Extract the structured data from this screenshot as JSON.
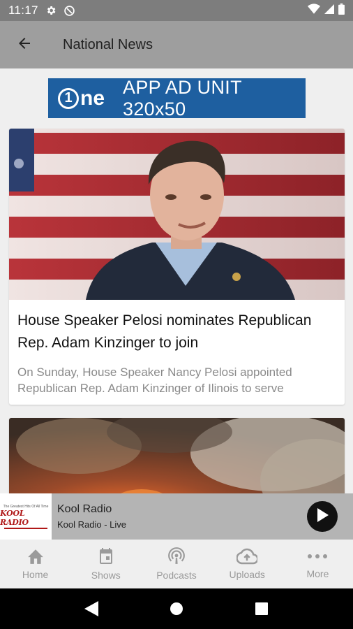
{
  "status_bar": {
    "time": "11:17",
    "icons_left": [
      "settings-gear-icon",
      "do-not-disturb-icon"
    ],
    "icons_right": [
      "wifi-icon",
      "cellular-signal-icon",
      "battery-icon"
    ]
  },
  "app_bar": {
    "back_icon": "arrow-left-icon",
    "title": "National News"
  },
  "ad_banner": {
    "logo": "1ne",
    "text": "APP AD UNIT 320x50",
    "color": "#1e5fa0"
  },
  "articles": [
    {
      "headline": "House Speaker Pelosi nominates Republican Rep. Adam Kinzinger to join",
      "summary": "On Sunday, House Speaker Nancy Pelosi appointed Republican Rep. Adam Kinzinger of Ilinois to serve",
      "image": "photo-man-speaking-in-front-of-american-flag"
    },
    {
      "headline": "",
      "summary": "",
      "image": "photo-wildfire-smoke"
    }
  ],
  "player": {
    "art_tagline": "The Greatest Hits Of All Time",
    "art_brand": "KOOL RADIO",
    "station": "Kool Radio",
    "subtitle": "Kool Radio - Live",
    "play_icon": "play-icon"
  },
  "bottom_nav": {
    "tabs": [
      {
        "label": "Home",
        "icon": "home-icon"
      },
      {
        "label": "Shows",
        "icon": "calendar-icon"
      },
      {
        "label": "Podcasts",
        "icon": "podcast-icon"
      },
      {
        "label": "Uploads",
        "icon": "cloud-upload-icon"
      },
      {
        "label": "More",
        "icon": "more-dots-icon"
      }
    ]
  },
  "system_nav": [
    "back-triangle-icon",
    "home-circle-icon",
    "recents-square-icon"
  ],
  "colors": {
    "status_bar": "#7d7d7d",
    "app_bar": "#9e9e9e",
    "player_bar": "#b4b4b4",
    "background": "#efefef"
  }
}
